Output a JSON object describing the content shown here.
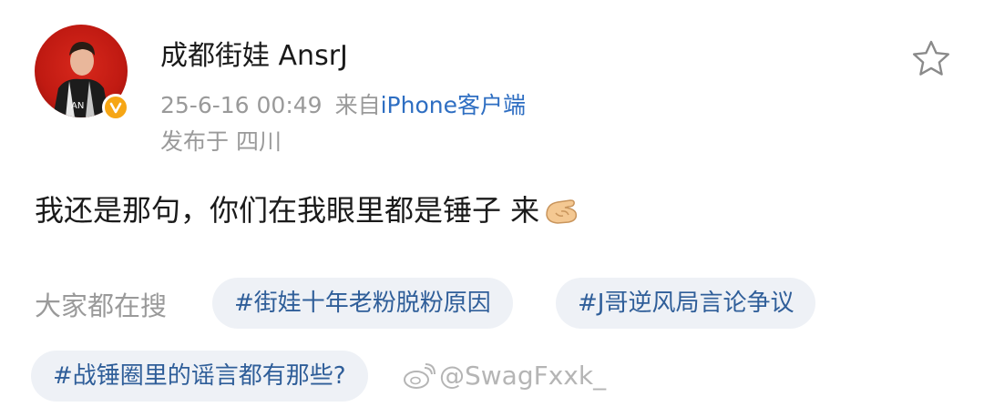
{
  "post": {
    "author": "成都街娃 AnsrJ",
    "date": "25-6-16 00:49",
    "from_label": "来自",
    "client": "iPhone客户端",
    "location_label": "发布于 四川",
    "text": "我还是那句，你们在我眼里都是锤子 来"
  },
  "trending": {
    "label": "大家都在搜",
    "tags": [
      "#街娃十年老粉脱粉原因",
      "#J哥逆风局言论争议",
      "#战锤圈里的谣言都有那些?"
    ]
  },
  "watermark": {
    "text": "@SwagFxxk_"
  },
  "icons": {
    "favorite": "star-outline-icon",
    "verified": "verified-badge-icon",
    "emoji": "hand-gesture-emoji",
    "logo": "weibo-logo-icon"
  },
  "colors": {
    "link_blue": "#2e6ec2",
    "tag_bg": "#eef1f6",
    "tag_text": "#2f5e99",
    "meta_gray": "#9a9a9a",
    "badge_orange": "#f6a615"
  }
}
